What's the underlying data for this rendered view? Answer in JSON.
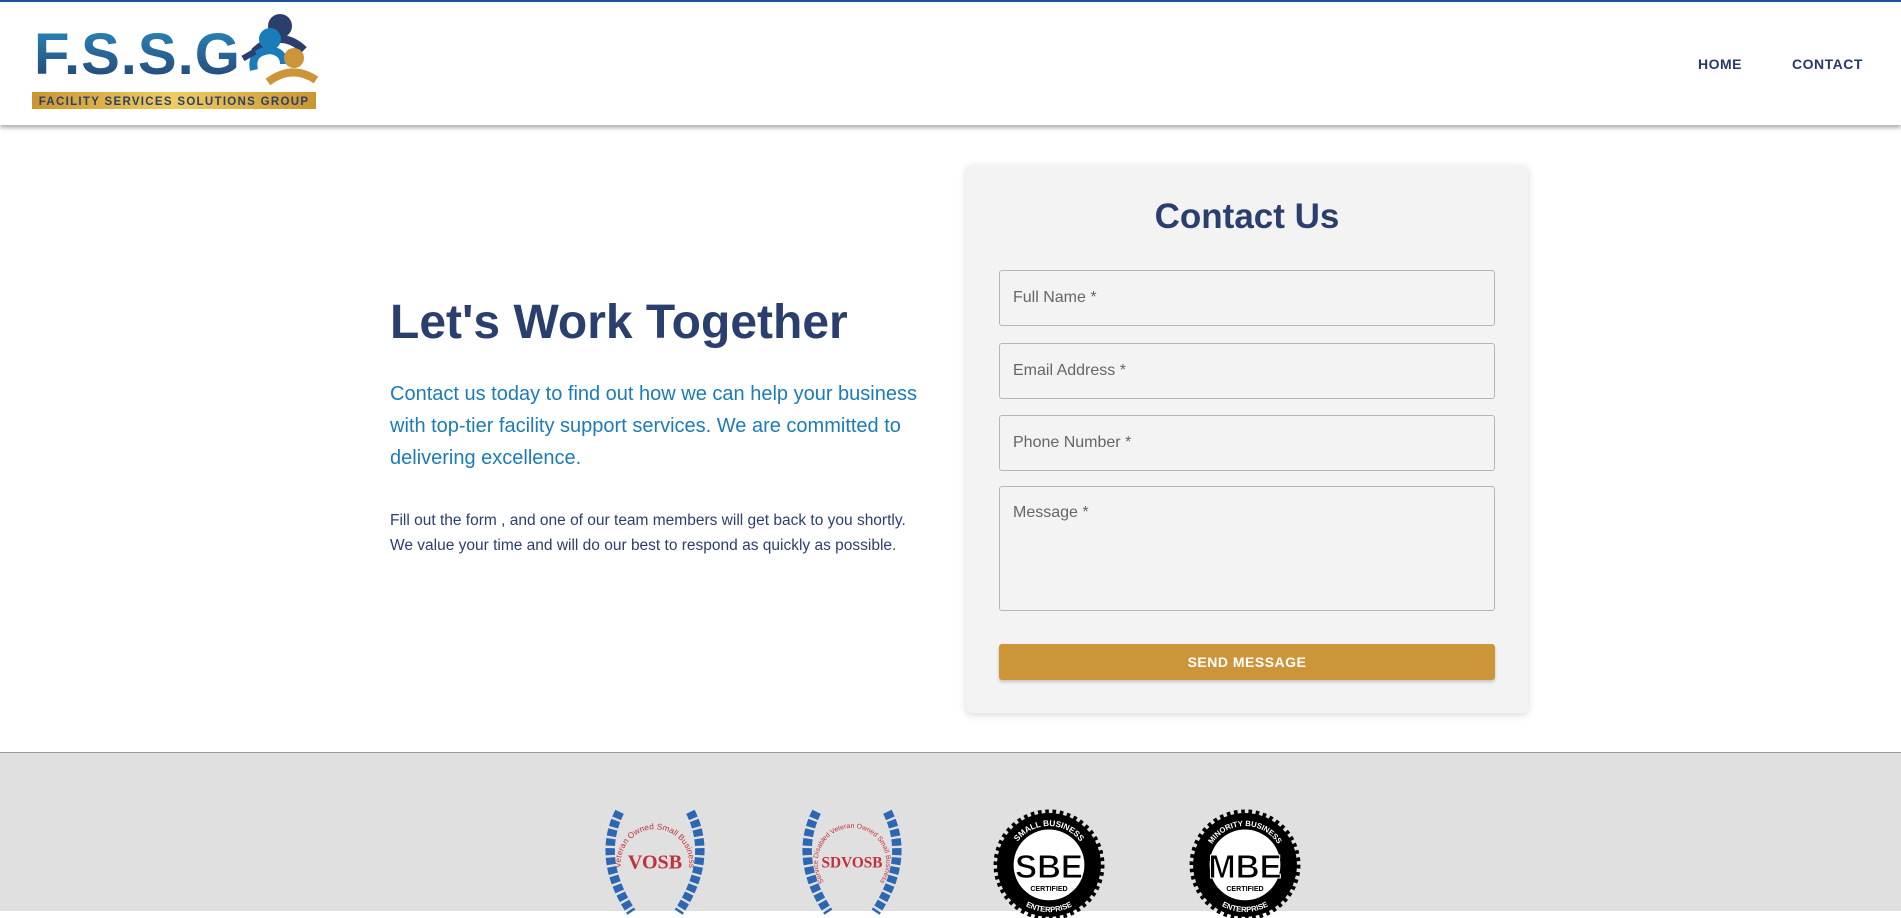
{
  "header": {
    "logo_text": "F.S.S.G",
    "logo_tagline": "FACILITY SERVICES SOLUTIONS GROUP",
    "nav": [
      {
        "label": "HOME"
      },
      {
        "label": "CONTACT"
      }
    ]
  },
  "intro": {
    "title": "Let's Work Together",
    "lead": "Contact us today to find out how we can help your business with top-tier facility support services. We are committed to delivering excellence.",
    "body": "Fill out the form , and one of our team members will get back to you shortly. We value your time and will do our best to respond as quickly as possible."
  },
  "form": {
    "title": "Contact Us",
    "fields": [
      {
        "placeholder": "Full Name *"
      },
      {
        "placeholder": "Email Address *"
      },
      {
        "placeholder": "Phone Number *"
      },
      {
        "placeholder": "Message *"
      }
    ],
    "submit_label": "SEND MESSAGE"
  },
  "badges": [
    {
      "label": "VOSB",
      "ring": "Veteran Owned Small Business"
    },
    {
      "label": "SDVOSB",
      "ring": "Service Disabled Veteran Owned Small Business"
    },
    {
      "label": "SBE",
      "top": "SMALL BUSINESS",
      "mid": "CERTIFIED",
      "bottom": "ENTERPRISE"
    },
    {
      "label": "MBE",
      "top": "MINORITY BUSINESS",
      "mid": "CERTIFIED",
      "bottom": "ENTERPRISE"
    }
  ],
  "colors": {
    "navy": "#2b3f6e",
    "blue": "#1a7cb8",
    "gold": "#cc9539"
  }
}
